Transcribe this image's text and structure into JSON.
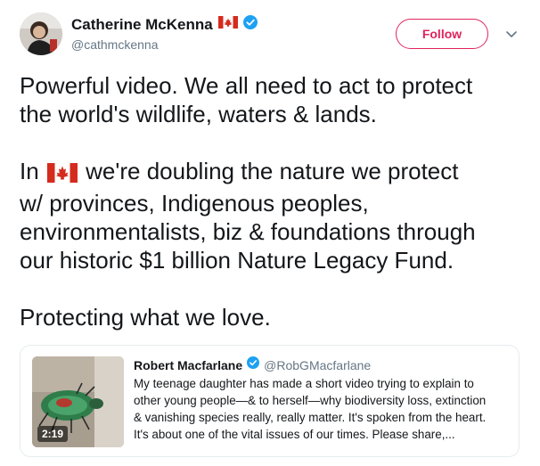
{
  "author": {
    "name": "Catherine McKenna",
    "handle": "@cathmckenna",
    "flag_icon": "canada-flag-icon",
    "verified_icon": "verified-badge-icon"
  },
  "actions": {
    "follow_label": "Follow",
    "menu_icon": "chevron-down-icon"
  },
  "tweet": {
    "line1": "Powerful video. We all need to act to protect",
    "line2": "the world's wildlife, waters & lands.",
    "line3_before_flag": "In",
    "line3_after_flag": "we're doubling the nature we protect",
    "line4": "w/ provinces, Indigenous peoples,",
    "line5": "environmentalists, biz & foundations through",
    "line6": "our historic $1 billion Nature Legacy Fund.",
    "line7": "Protecting what we love."
  },
  "quoted": {
    "name": "Robert Macfarlane",
    "handle": "@RobGMacfarlane",
    "video_duration": "2:19",
    "text_lines": [
      "My teenage daughter has made a short video trying to explain to",
      "other young people—& to herself—why biodiversity loss, extinction",
      "& vanishing species really, really matter. It's spoken from the heart.",
      "It's about one of the vital issues of our times. Please share,..."
    ]
  },
  "colors": {
    "follow_accent": "#e0245e",
    "verified_blue": "#1da1f2",
    "secondary_text": "#657786",
    "flag_red": "#d52b1e"
  }
}
